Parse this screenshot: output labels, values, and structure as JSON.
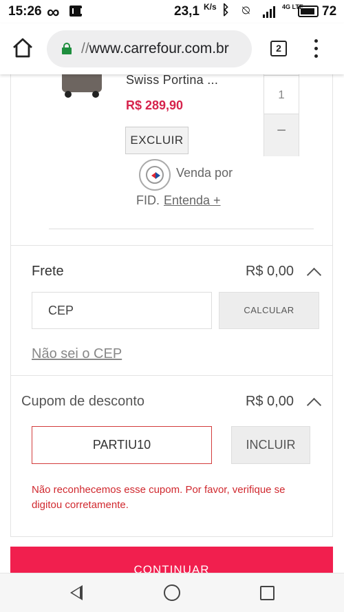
{
  "status_bar": {
    "time": "15:26",
    "speed": "23,1",
    "speed_unit": "K/s",
    "network": "4G LTE",
    "battery": "72"
  },
  "browser": {
    "url_scheme": "//",
    "url_host": "www.carrefour.com.br",
    "tab_count": "2",
    "icons": [
      "home-icon",
      "lock-icon",
      "tabs-icon",
      "menu-icon"
    ]
  },
  "product": {
    "name": "Swiss Portina ...",
    "price": "R$ 289,90",
    "quantity": "1",
    "minus_label": "−",
    "delete_label": "EXCLUIR",
    "seller_prefix": "Venda por",
    "seller_name": "FID.",
    "seller_link": "Entenda +"
  },
  "frete": {
    "title": "Frete",
    "amount": "R$ 0,00",
    "cep_placeholder": "CEP",
    "calculate_label": "CALCULAR",
    "dont_know_cep": "Não sei o CEP"
  },
  "cupom": {
    "title": "Cupom de desconto",
    "amount": "R$ 0,00",
    "code_value": "PARTIU10",
    "include_label": "INCLUIR",
    "error_message": "Não reconhecemos esse cupom. Por favor, verifique se digitou corretamente."
  },
  "actions": {
    "continue_label": "CONTINUAR"
  },
  "colors": {
    "accent": "#f11f4e",
    "price": "#d6234c",
    "error": "#d0282e",
    "secure": "#1e8e3e"
  }
}
